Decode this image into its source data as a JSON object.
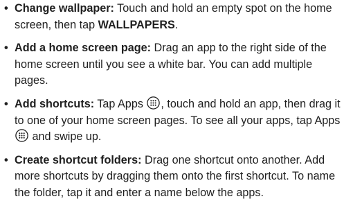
{
  "bullet": "•",
  "tips": [
    {
      "title": "Change wallpaper:",
      "text_a": " Touch and hold an empty spot on the home screen, then tap ",
      "keyword": "WALLPAPERS",
      "text_b": "."
    },
    {
      "title": "Add a home screen page:",
      "text_a": " Drag an app to the right side of the home screen until you see a white bar. You can add multiple pages."
    },
    {
      "title": "Add shortcuts:",
      "text_a": " Tap Apps ",
      "text_b": ", touch and hold an app, then drag it to one of your home screen pages. To see all your apps, tap Apps ",
      "text_c": " and swipe up.",
      "icon": "apps-icon"
    },
    {
      "title": "Create shortcut folders:",
      "text_a": " Drag one shortcut onto another. Add more shortcuts by dragging them onto the first shortcut. To name the folder, tap it and enter a name below the apps."
    }
  ]
}
